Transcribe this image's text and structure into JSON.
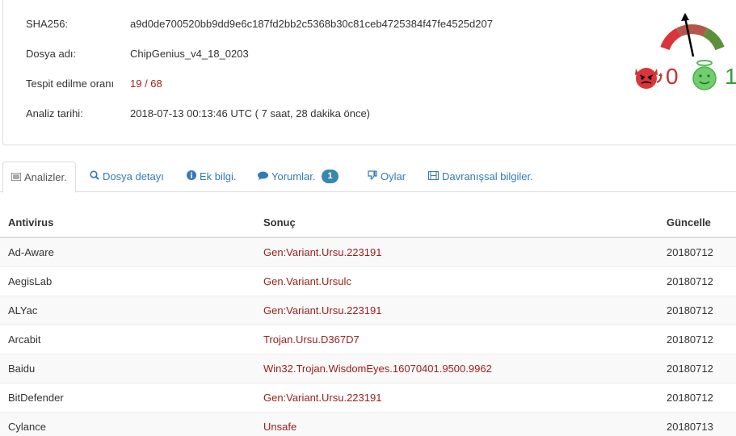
{
  "summary": {
    "sha_label": "SHA256:",
    "sha_value": "a9d0de700520bb9dd9e6c187fd2bb2c5368b30c81ceb4725384f47fe4525d207",
    "file_label": "Dosya adı:",
    "file_value": "ChipGenius_v4_18_0203",
    "ratio_label": "Tespit edilme oranı",
    "ratio_value": "19 / 68",
    "date_label": "Analiz tarihi:",
    "date_value": "2018-07-13 00:13:46 UTC ( 7 saat, 28 dakika önce)"
  },
  "votes": {
    "malicious": "0",
    "harmless": "1",
    "malicious_icon": "devil-icon",
    "harmless_icon": "angel-icon"
  },
  "tabs": [
    {
      "label": "Analizler.",
      "icon": "list-icon"
    },
    {
      "label": "Dosya detayı",
      "icon": "search-icon"
    },
    {
      "label": "Ek bilgi.",
      "icon": "info-icon"
    },
    {
      "label": "Yorumlar.",
      "icon": "comment-icon",
      "badge": "1"
    },
    {
      "label": "Oylar",
      "icon": "thumbs-down-icon"
    },
    {
      "label": "Davranışsal bilgiler.",
      "icon": "film-icon"
    }
  ],
  "table": {
    "headers": [
      "Antivirus",
      "Sonuç",
      "Güncelle"
    ],
    "rows": [
      [
        "Ad-Aware",
        "Gen:Variant.Ursu.223191",
        "20180712"
      ],
      [
        "AegisLab",
        "Gen.Variant.Ursulc",
        "20180712"
      ],
      [
        "ALYac",
        "Gen:Variant.Ursu.223191",
        "20180712"
      ],
      [
        "Arcabit",
        "Trojan.Ursu.D367D7",
        "20180712"
      ],
      [
        "Baidu",
        "Win32.Trojan.WisdomEyes.16070401.9500.9962",
        "20180712"
      ],
      [
        "BitDefender",
        "Gen:Variant.Ursu.223191",
        "20180712"
      ],
      [
        "Cylance",
        "Unsafe",
        "20180713"
      ]
    ]
  },
  "colors": {
    "link": "#337ab7",
    "detection_red": "#9b1c1c",
    "badge": "#3a87ad"
  }
}
